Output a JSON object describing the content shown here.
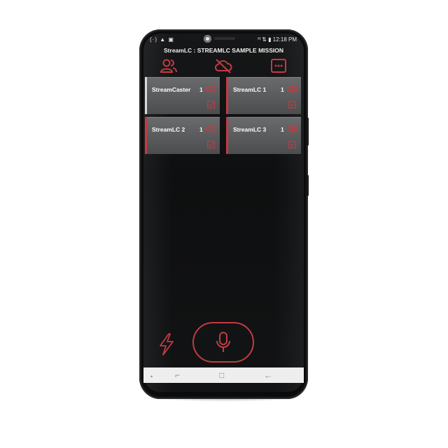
{
  "colors": {
    "accent": "#c43a43",
    "tile_bg": "#595a5c",
    "tile_accent_white": "#d9d9d9",
    "screen_bg": "#131415",
    "navbar_bg": "#eeeeef"
  },
  "statusbar": {
    "left_icons": "(·) ▲ ▣",
    "right_icons": "ᴴ ⇅ ▮",
    "time": "12:18 PM"
  },
  "app": {
    "title": "StreamLC : STREAMLC SAMPLE MISSION"
  },
  "toolbar": {
    "icons": [
      "users-icon",
      "cloud-offline-icon",
      "more-menu-icon"
    ]
  },
  "channels": [
    {
      "name": "StreamCaster",
      "count": "1",
      "accent": "white",
      "checked": true
    },
    {
      "name": "StreamLC 1",
      "count": "1",
      "accent": "red",
      "checked": true
    },
    {
      "name": "StreamLC 2",
      "count": "1",
      "accent": "red",
      "checked": true
    },
    {
      "name": "StreamLC 3",
      "count": "1",
      "accent": "red",
      "checked": true
    }
  ],
  "controls": {
    "bolt_icon": "lightning-icon",
    "mic_icon": "microphone-icon"
  },
  "navbar": {
    "dot": "•",
    "recent": "⌐",
    "home": "□",
    "back": "←"
  }
}
